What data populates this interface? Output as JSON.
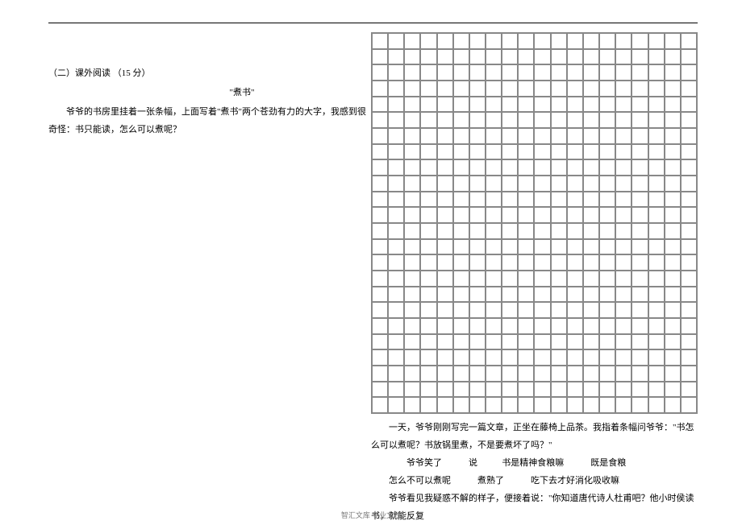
{
  "left": {
    "section_heading": "（二）课外阅读 （15 分）",
    "title": "\"煮书\"",
    "para1": "爷爷的书房里挂着一张条幅，上面写着\"煮书\"两个苍劲有力的大字，我感到很奇怪：书只能读，怎么可以煮呢？"
  },
  "right": {
    "p1": "一天，爷爷刚刚写完一篇文章，正坐在藤椅上品茶。我指着条幅问爷爷：\"书怎么可以煮呢？书放锅里煮，不是要煮坏了吗？\"",
    "p2_parts": {
      "a": "爷爷笑了",
      "b": "说",
      "c": "书是精神食粮嘛",
      "d": "既是食粮",
      "e": "怎么不可以煮呢",
      "f": "煮熟了",
      "g": "吃下去才好消化吸收嘛"
    },
    "p3": "爷爷看见我疑惑不解的样子，便接着说：\"你知道唐代诗人杜甫吧？他小时侯读书，就能反复"
  },
  "footer": "智汇文库 专业文档",
  "grid": {
    "cols": 20,
    "rows": 24
  }
}
